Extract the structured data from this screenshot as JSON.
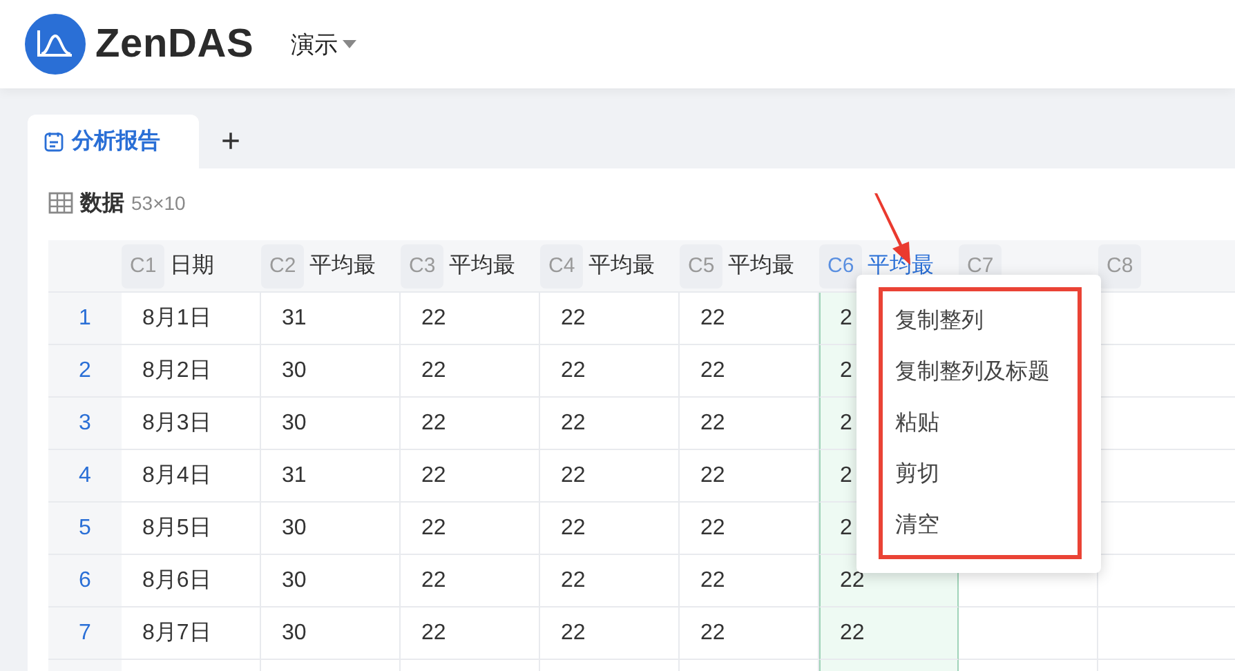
{
  "header": {
    "brand": "ZenDAS",
    "workspace": "演示"
  },
  "tabs": [
    {
      "label": "分析报告",
      "selected": true
    }
  ],
  "add_tab": "+",
  "dataset": {
    "title": "数据",
    "size": "53×10"
  },
  "table": {
    "columns": [
      {
        "code": "C1",
        "title": "日期",
        "selected": false
      },
      {
        "code": "C2",
        "title": "平均最",
        "selected": false
      },
      {
        "code": "C3",
        "title": "平均最",
        "selected": false
      },
      {
        "code": "C4",
        "title": "平均最",
        "selected": false
      },
      {
        "code": "C5",
        "title": "平均最",
        "selected": false
      },
      {
        "code": "C6",
        "title": "平均最",
        "selected": true
      },
      {
        "code": "C7",
        "selected": false
      },
      {
        "code": "C8",
        "selected": false
      }
    ],
    "rows": [
      {
        "number": "1",
        "cells": [
          "8月1日",
          "31",
          "22",
          "22",
          "22",
          "2"
        ]
      },
      {
        "number": "2",
        "cells": [
          "8月2日",
          "30",
          "22",
          "22",
          "22",
          "2"
        ]
      },
      {
        "number": "3",
        "cells": [
          "8月3日",
          "30",
          "22",
          "22",
          "22",
          "2"
        ]
      },
      {
        "number": "4",
        "cells": [
          "8月4日",
          "31",
          "22",
          "22",
          "22",
          "2"
        ]
      },
      {
        "number": "5",
        "cells": [
          "8月5日",
          "30",
          "22",
          "22",
          "22",
          "2"
        ]
      },
      {
        "number": "6",
        "cells": [
          "8月6日",
          "30",
          "22",
          "22",
          "22",
          "22"
        ]
      },
      {
        "number": "7",
        "cells": [
          "8月7日",
          "30",
          "22",
          "22",
          "22",
          "22"
        ]
      }
    ]
  },
  "context_menu": {
    "items": [
      "复制整列",
      "复制整列及标题",
      "粘贴",
      "剪切",
      "清空"
    ]
  }
}
